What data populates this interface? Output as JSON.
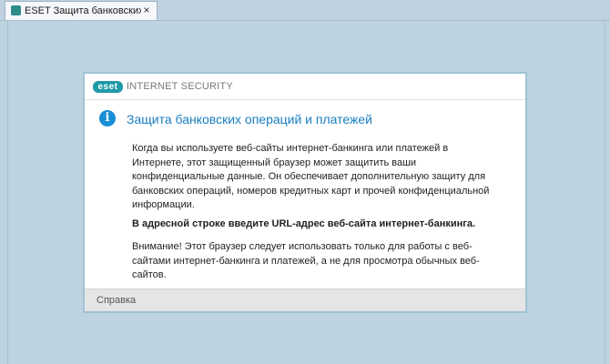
{
  "browser": {
    "tab_title": "ESET Защита банковских ...",
    "tab_close": "×"
  },
  "dialog": {
    "logo_text": "eset",
    "product": "INTERNET SECURITY",
    "title": "Защита банковских операций и платежей",
    "paragraph1": "Когда вы используете веб-сайты интернет-банкинга или платежей в Интернете, этот защищенный браузер может защитить ваши конфиденциальные данные. Он обеспечивает дополнительную защиту для банковских операций, номеров кредитных карт и прочей конфиденциальной информации.",
    "paragraph2": "В адресной строке введите URL-адрес веб-сайта интернет-банкинга.",
    "paragraph3": "Внимание! Этот браузер следует использовать только для работы с веб-сайтами интернет-банкинга и платежей, а не для просмотра обычных веб-сайтов.",
    "help": "Справка",
    "info_icon": "i"
  },
  "colors": {
    "accent": "#1a7ec2",
    "brand": "#1f9aa6",
    "background": "#bdd3df"
  },
  "icons": {
    "tab": "eset-tab-icon",
    "info": "info-icon",
    "close": "close-icon"
  }
}
